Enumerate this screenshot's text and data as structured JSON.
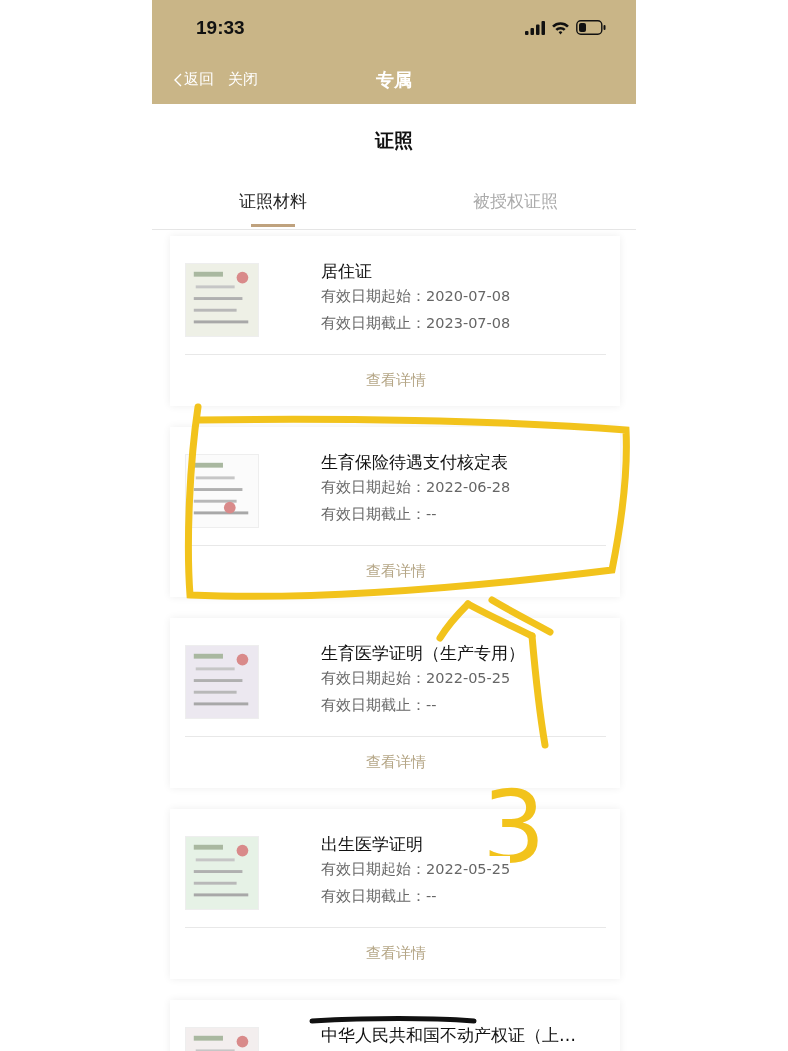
{
  "status_bar": {
    "time": "19:33"
  },
  "nav": {
    "back": "返回",
    "close": "关闭",
    "title": "专属"
  },
  "page_title": "证照",
  "tabs": [
    {
      "label": "证照材料",
      "selected": true
    },
    {
      "label": "被授权证照",
      "selected": false
    }
  ],
  "documents": [
    {
      "title": "居住证",
      "start": "有效日期起始：2020-07-08",
      "end": "有效日期截止：2023-07-08",
      "action": "查看详情"
    },
    {
      "title": "生育保险待遇支付核定表",
      "start": "有效日期起始：2022-06-28",
      "end": "有效日期截止：--",
      "action": "查看详情"
    },
    {
      "title": "生育医学证明（生产专用）",
      "start": "有效日期起始：2022-05-25",
      "end": "有效日期截止：--",
      "action": "查看详情"
    },
    {
      "title": "出生医学证明",
      "start": "有效日期起始：2022-05-25",
      "end": "有效日期截止：--",
      "action": "查看详情"
    },
    {
      "title": "中华人民共和国不动产权证（上…"
    }
  ],
  "annotations": [
    {
      "kind": "box"
    },
    {
      "kind": "arrow"
    },
    {
      "kind": "note",
      "text": "3"
    },
    {
      "kind": "strike"
    }
  ]
}
